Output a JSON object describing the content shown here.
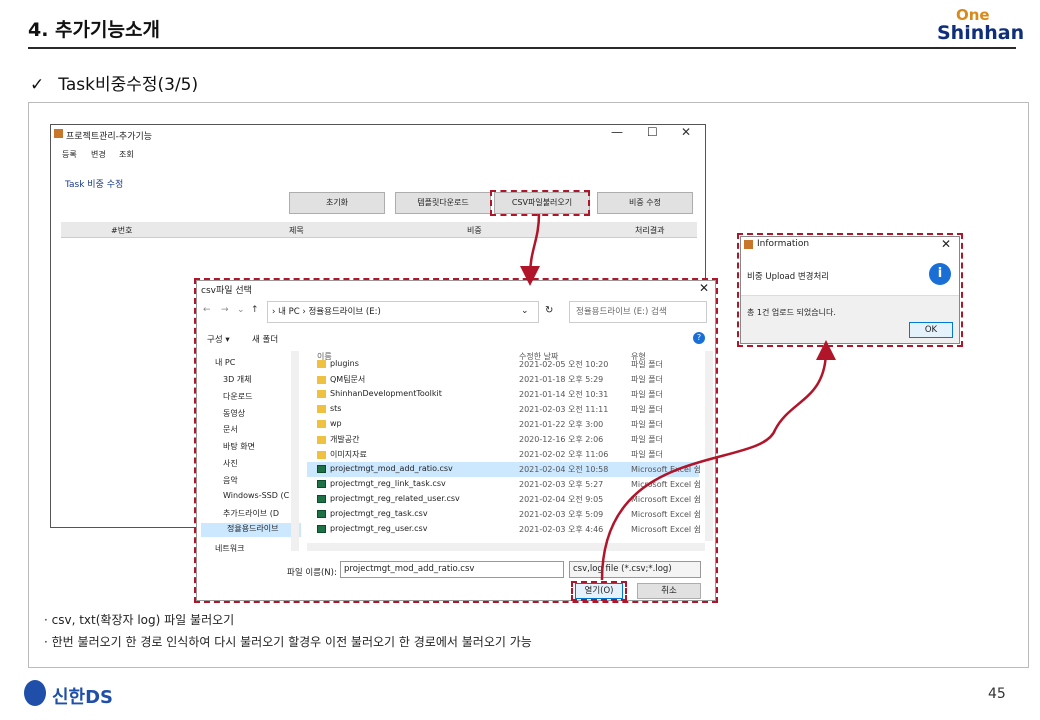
{
  "header": {
    "title": "4. 추가기능소개",
    "logo_one": "One",
    "logo_shinhan": "Shinhan"
  },
  "subtitle": {
    "check": "✓",
    "text": "Task비중수정(3/5)"
  },
  "main_window": {
    "title": "프로젝트관리-추가기능",
    "controls": [
      "—",
      "☐",
      "✕"
    ],
    "menu": [
      "등록",
      "변경",
      "조회"
    ],
    "section_label": "Task 비중 수정",
    "buttons": [
      "초기화",
      "템플릿다운로드",
      "CSV파일불러오기",
      "비중 수정"
    ],
    "columns": [
      "#번호",
      "제목",
      "비중",
      "처리결과"
    ]
  },
  "file_dialog": {
    "title": "csv파일 선택",
    "close": "✕",
    "nav": [
      "←",
      "→",
      "⌄",
      "↑"
    ],
    "address": "› 내 PC › 정율용드라이브 (E:)",
    "refresh": "↻",
    "dropdown": "⌄",
    "search_placeholder": "정율용드라이브 (E:) 검색",
    "toolbar": {
      "organize": "구성 ▾",
      "new_folder": "새 폴더"
    },
    "tree": [
      "내 PC",
      "3D 개체",
      "다운로드",
      "동영상",
      "문서",
      "바탕 화면",
      "사진",
      "음악",
      "Windows-SSD (C",
      "추가드라이브 (D",
      "정율용드라이브"
    ],
    "tree_footer": "네트워크",
    "columns": {
      "name": "이름",
      "date": "수정한 날짜",
      "type": "유형"
    },
    "files": [
      {
        "name": "plugins",
        "date": "2021-02-05 오전 10:20",
        "type": "파일 폴더",
        "kind": "folder"
      },
      {
        "name": "QM팀문서",
        "date": "2021-01-18 오후 5:29",
        "type": "파일 폴더",
        "kind": "folder"
      },
      {
        "name": "ShinhanDevelopmentToolkit",
        "date": "2021-01-14 오전 10:31",
        "type": "파일 폴더",
        "kind": "folder"
      },
      {
        "name": "sts",
        "date": "2021-02-03 오전 11:11",
        "type": "파일 폴더",
        "kind": "folder"
      },
      {
        "name": "wp",
        "date": "2021-01-22 오후 3:00",
        "type": "파일 폴더",
        "kind": "folder"
      },
      {
        "name": "개발공간",
        "date": "2020-12-16 오후 2:06",
        "type": "파일 폴더",
        "kind": "folder"
      },
      {
        "name": "이미지자료",
        "date": "2021-02-02 오후 11:06",
        "type": "파일 폴더",
        "kind": "folder"
      },
      {
        "name": "projectmgt_mod_add_ratio.csv",
        "date": "2021-02-04 오전 10:58",
        "type": "Microsoft Excel 쉼",
        "kind": "xl"
      },
      {
        "name": "projectmgt_reg_link_task.csv",
        "date": "2021-02-03 오후 5:27",
        "type": "Microsoft Excel 쉼",
        "kind": "xl"
      },
      {
        "name": "projectmgt_reg_related_user.csv",
        "date": "2021-02-04 오전 9:05",
        "type": "Microsoft Excel 쉼",
        "kind": "xl"
      },
      {
        "name": "projectmgt_reg_task.csv",
        "date": "2021-02-03 오후 5:09",
        "type": "Microsoft Excel 쉼",
        "kind": "xl"
      },
      {
        "name": "projectmgt_reg_user.csv",
        "date": "2021-02-03 오후 4:46",
        "type": "Microsoft Excel 쉼",
        "kind": "xl"
      }
    ],
    "filename_label": "파일 이름(N):",
    "filename_value": "projectmgt_mod_add_ratio.csv",
    "filetype_value": "csv,log file (*.csv;*.log)",
    "open_label": "열기(O)",
    "cancel_label": "취소"
  },
  "info_dialog": {
    "title": "Information",
    "close": "✕",
    "message": "비중 Upload 변경처리",
    "icon": "i",
    "detail": "총 1건 업로드 되었습니다.",
    "ok": "OK"
  },
  "bullets": [
    "csv, txt(확장자 log) 파일 불러오기",
    "한번 불러오기 한 경로 인식하여 다시 불러오기 할경우 이전 불러오기 한 경로에서 불러오기 가능"
  ],
  "footer": {
    "brand": "신한DS",
    "page": "45"
  },
  "colors": {
    "accent_dash": "#b0152a",
    "brand_blue": "#1f4fa8",
    "brand_orange": "#d98a1a",
    "selection": "#cce8ff"
  }
}
